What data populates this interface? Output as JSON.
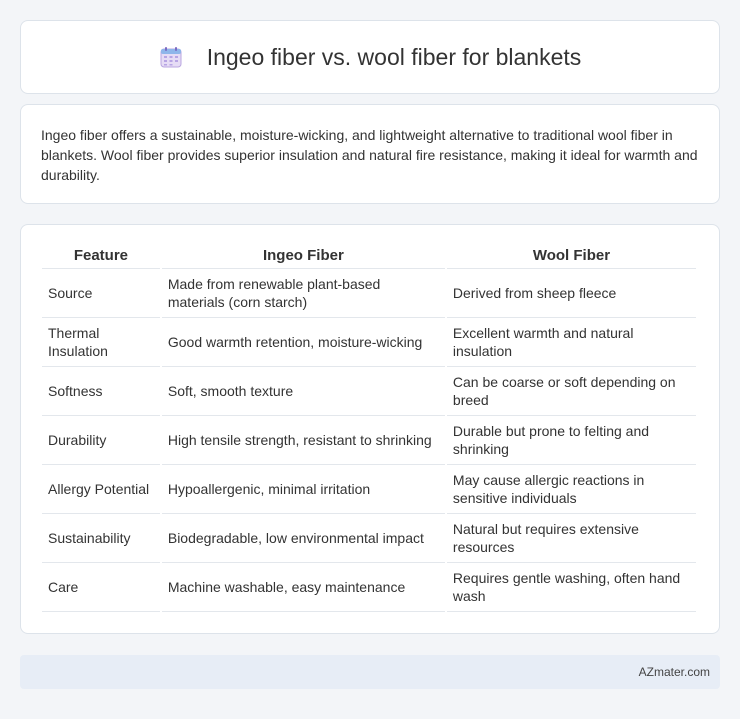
{
  "header": {
    "title": "Ingeo fiber vs. wool fiber for blankets",
    "icon": "calendar-icon"
  },
  "summary": {
    "text": "Ingeo fiber offers a sustainable, moisture-wicking, and lightweight alternative to traditional wool fiber in blankets. Wool fiber provides superior insulation and natural fire resistance, making it ideal for warmth and durability."
  },
  "table": {
    "columns": [
      "Feature",
      "Ingeo Fiber",
      "Wool Fiber"
    ],
    "rows": [
      [
        "Source",
        "Made from renewable plant-based materials (corn starch)",
        "Derived from sheep fleece"
      ],
      [
        "Thermal Insulation",
        "Good warmth retention, moisture-wicking",
        "Excellent warmth and natural insulation"
      ],
      [
        "Softness",
        "Soft, smooth texture",
        "Can be coarse or soft depending on breed"
      ],
      [
        "Durability",
        "High tensile strength, resistant to shrinking",
        "Durable but prone to felting and shrinking"
      ],
      [
        "Allergy Potential",
        "Hypoallergenic, minimal irritation",
        "May cause allergic reactions in sensitive individuals"
      ],
      [
        "Sustainability",
        "Biodegradable, low environmental impact",
        "Natural but requires extensive resources"
      ],
      [
        "Care",
        "Machine washable, easy maintenance",
        "Requires gentle washing, often hand wash"
      ]
    ]
  },
  "footer": {
    "brand": "AZmater.com"
  }
}
